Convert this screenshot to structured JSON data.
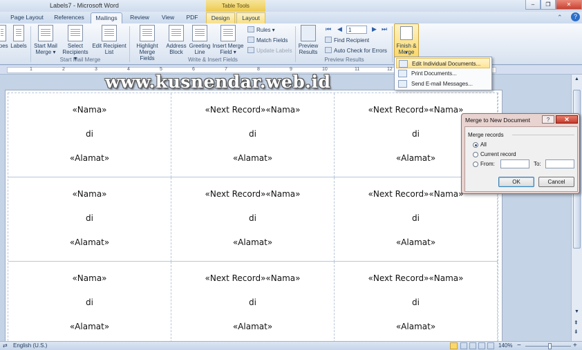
{
  "window": {
    "title": "Labels7  -  Microsoft Word",
    "contextual_group": "Table Tools",
    "controls": {
      "minimize": "–",
      "restore": "❐",
      "close": "✕"
    }
  },
  "tabs": [
    "Page Layout",
    "References",
    "Mailings",
    "Review",
    "View",
    "PDF",
    "Design",
    "Layout"
  ],
  "active_tab": "Mailings",
  "ribbon": {
    "create_group": {
      "envelopes": "opes",
      "labels": "Labels"
    },
    "start_group": {
      "label": "Start Mail Merge",
      "start_mail_merge": "Start Mail Merge",
      "select_recipients": "Select Recipients",
      "edit_recipient_list": "Edit Recipient List"
    },
    "write_group": {
      "label": "Write & Insert Fields",
      "highlight_merge_fields": "Highlight Merge Fields",
      "address_block": "Address Block",
      "greeting_line": "Greeting Line",
      "insert_merge_field": "Insert Merge Field",
      "rules": "Rules",
      "match_fields": "Match Fields",
      "update_labels": "Update Labels"
    },
    "preview_group": {
      "label": "Preview Results",
      "preview_results": "Preview Results",
      "record_number": "1",
      "find_recipient": "Find Recipient",
      "auto_check": "Auto Check for Errors"
    },
    "finish_group": {
      "finish_merge": "Finish & Merge"
    }
  },
  "finish_menu": [
    {
      "label": "Edit Individual Documents...",
      "icon": "edit-documents-icon",
      "highlighted": true
    },
    {
      "label": "Print Documents...",
      "icon": "print-icon",
      "highlighted": false
    },
    {
      "label": "Send E-mail Messages...",
      "icon": "email-icon",
      "highlighted": false
    }
  ],
  "watermark": "www.kusnendar.web.id",
  "ruler_numbers": [
    "1",
    "2",
    "3",
    "4",
    "5",
    "6",
    "7",
    "8",
    "9",
    "10",
    "11",
    "12",
    "13",
    "14",
    "15"
  ],
  "labels": [
    [
      "«Nama»",
      "di",
      "«Alamat»"
    ],
    [
      "«Next Record»«Nama»",
      "di",
      "«Alamat»"
    ],
    [
      "«Next Record»«Nama»",
      "di",
      "«Alamat»"
    ],
    [
      "«Nama»",
      "di",
      "«Alamat»"
    ],
    [
      "«Next Record»«Nama»",
      "di",
      "«Alamat»"
    ],
    [
      "«Next Record»«Nama»",
      "di",
      "«Alamat»"
    ],
    [
      "«Nama»",
      "di",
      "«Alamat»"
    ],
    [
      "«Next Record»«Nama»",
      "di",
      "«Alamat»"
    ],
    [
      "«Next Record»«Nama»",
      "di",
      "«Alamat»"
    ]
  ],
  "dialog": {
    "title": "Merge to New Document",
    "help": "?",
    "close": "✕",
    "group_label": "Merge records",
    "option_all": "All",
    "option_current": "Current record",
    "option_from": "From:",
    "to_label": "To:",
    "from_value": "",
    "to_value": "",
    "selected_option": "All",
    "ok": "OK",
    "cancel": "Cancel"
  },
  "statusbar": {
    "language": "English (U.S.)",
    "zoom": "140%",
    "zoom_minus": "−",
    "zoom_plus": "+"
  },
  "colors": {
    "accent_finish": "#fbd86a",
    "ribbon_text": "#1e395b",
    "dialog_frame": "#e8d3d0",
    "close_red": "#c4392a"
  }
}
